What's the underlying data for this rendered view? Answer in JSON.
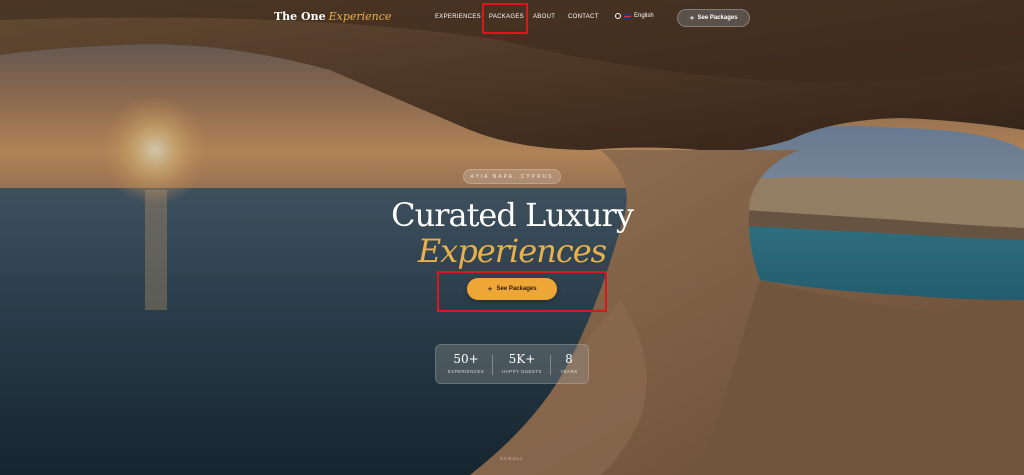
{
  "brand": {
    "name": "The One",
    "accent": "Experience"
  },
  "nav": {
    "links": [
      {
        "label": "EXPERIENCES"
      },
      {
        "label": "PACKAGES"
      },
      {
        "label": "ABOUT"
      },
      {
        "label": "CONTACT"
      }
    ],
    "language": "English",
    "cta_label": "See Packages"
  },
  "hero": {
    "kicker": "AYIA NAPA, CYPRUS",
    "title_line1": "Curated Luxury",
    "title_line2": "Experiences",
    "cta_label": "See Packages",
    "stats": [
      {
        "value": "50+",
        "label": "EXPERIENCES"
      },
      {
        "value": "5K+",
        "label": "HAPPY GUESTS"
      },
      {
        "value": "8",
        "label": "YEARS"
      }
    ],
    "scroll_label": "SCROLL"
  },
  "colors": {
    "accent": "#e9b04c",
    "cta_bg": "#eea736",
    "highlight": "#e0141b"
  },
  "icons": [
    "globe-icon",
    "flag-icon",
    "sparkle-icon"
  ]
}
